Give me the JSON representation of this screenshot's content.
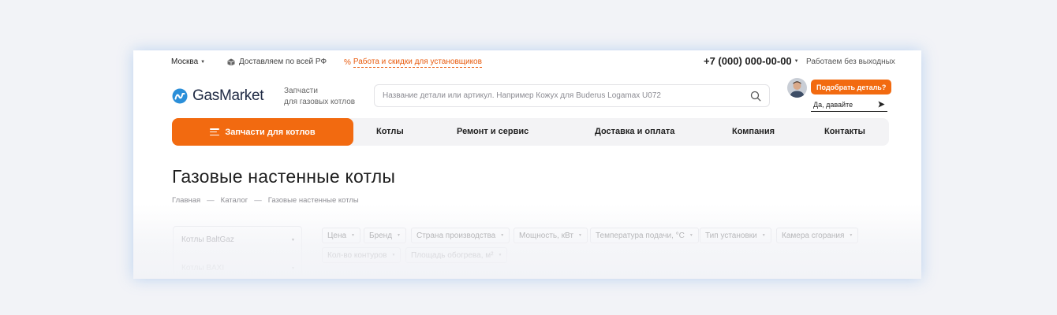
{
  "topbar": {
    "city": "Москва",
    "delivery": "Доставляем по всей РФ",
    "promo": "Работа и скидки для установщиков",
    "promo_symbol": "%",
    "phone": "+7 (000) 000-00-00",
    "work_hours": "Работаем без выходных"
  },
  "header": {
    "logo_text": "GasMarket",
    "tagline_line1": "Запчасти",
    "tagline_line2": "для газовых котлов",
    "search_placeholder": "Название детали или артикул. Например Кожух для Buderus Logamax U072",
    "chat_bubble": "Подобрать деталь?",
    "chat_reply": "Да, давайте"
  },
  "nav": {
    "primary": "Запчасти для котлов",
    "items": [
      "Котлы",
      "Ремонт и сервис",
      "Доставка и оплата",
      "Компания",
      "Контакты"
    ]
  },
  "page": {
    "title": "Газовые настенные котлы",
    "breadcrumb": [
      "Главная",
      "Каталог",
      "Газовые настенные котлы"
    ],
    "breadcrumb_separator": "—"
  },
  "sidebar": {
    "items": [
      "Котлы BaltGaz",
      "Котлы BAXI"
    ]
  },
  "filters": {
    "row1": [
      "Цена",
      "Бренд",
      "Страна производства",
      "Мощность, кВт",
      "Температура подачи, °C",
      "Тип установки",
      "Камера сгорания"
    ],
    "row2": [
      "Кол-во контуров",
      "Площадь обогрева, м²"
    ]
  },
  "colors": {
    "accent": "#f26a10",
    "logo_blue": "#2b8fd9",
    "background": "#f2f3f7"
  }
}
